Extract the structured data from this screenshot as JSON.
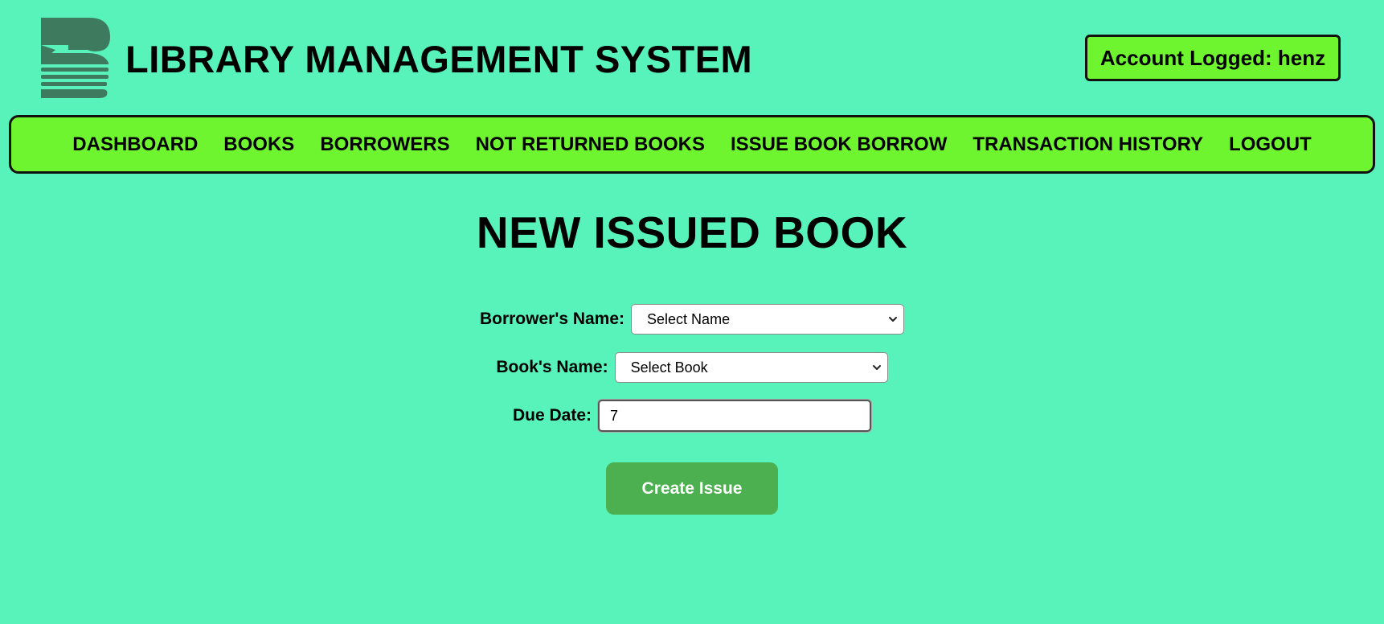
{
  "header": {
    "logo_icon": "book-stack-logo-icon",
    "title": "LIBRARY MANAGEMENT SYSTEM",
    "account_label": "Account Logged: henz"
  },
  "nav": {
    "items": [
      {
        "label": "DASHBOARD"
      },
      {
        "label": "BOOKS"
      },
      {
        "label": "BORROWERS"
      },
      {
        "label": "NOT RETURNED BOOKS"
      },
      {
        "label": "ISSUE BOOK BORROW"
      },
      {
        "label": "TRANSACTION HISTORY"
      },
      {
        "label": "LOGOUT"
      }
    ]
  },
  "main": {
    "title": "NEW ISSUED BOOK",
    "form": {
      "borrower_label": "Borrower's Name:",
      "borrower_selected": "Select Name",
      "book_label": "Book's Name:",
      "book_selected": "Select Book",
      "due_date_label": "Due Date:",
      "due_date_value": "7",
      "submit_label": "Create Issue"
    }
  },
  "colors": {
    "background": "#58f2bb",
    "accent": "#6ff52f",
    "button": "#4caf50",
    "logo": "#3d7a5e"
  }
}
